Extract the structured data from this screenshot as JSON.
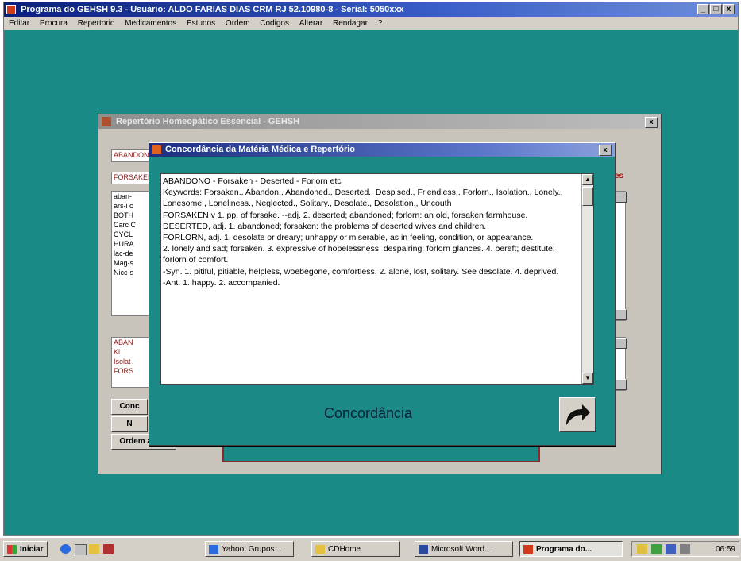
{
  "window": {
    "title": "Programa do GEHSH 9.3 - Usuário: ALDO FARIAS DIAS CRM RJ 52.10980-8 - Serial: 5050xxx",
    "buttons": [
      "_",
      "□",
      "x"
    ]
  },
  "menu": [
    "Editar",
    "Procura",
    "Repertorio",
    "Medicamentos",
    "Estudos",
    "Ordem",
    "Codigos",
    "Alterar",
    "Rendagar",
    "?"
  ],
  "back_dialog": {
    "title": "Repertório Homeopático Essencial - GEHSH",
    "close": "x",
    "field_top_1": "ABANDONO",
    "field_top_2": "FORSAKEN",
    "right_label": "es",
    "list_items": [
      "aban-",
      "ars-i c",
      "BOTH",
      "Carc C",
      "CYCL",
      "HURA",
      "lac-de",
      "Mag-s",
      "Nicc-s"
    ],
    "field_bottom": [
      "ABAN",
      "Ki",
      "Isolat",
      "FORS"
    ],
    "button_conc": "Conc",
    "button_n": "N",
    "button_order": "Ordem alfab."
  },
  "front_dialog": {
    "title": "Concordância da Matéria Médica e Repertório",
    "close": "x",
    "paragraphs": [
      "ABANDONO - Forsaken - Deserted - Forlorn etc",
      "      Keywords: Forsaken., Abandon., Abandoned., Deserted., Despised., Friendless., Forlorn., Isolation., Lonely., Lonesome., Loneliness., Neglected., Solitary., Desolate., Desolation., Uncouth",
      "FORSAKEN v 1.    pp. of forsake. --adj. 2.     deserted; abandoned; forlorn: an old, forsaken farmhouse.",
      "DESERTED, adj. 1.    abandoned; forsaken: the problems of deserted wives and children.",
      "FORLORN, adj. 1.     desolate or dreary; unhappy or miserable, as in feeling, condition, or appearance.",
      "2.  lonely and sad; forsaken. 3.  expressive of hopelessness; despairing: forlorn glances. 4.     bereft; destitute: forlorn of comfort.",
      "-Syn. 1. pitiful, pitiable, helpless, woebegone, comfortless. 2. alone, lost, solitary. See desolate. 4. deprived.",
      "-Ant. 1. happy. 2. accompanied."
    ],
    "bottom_label": "Concordância",
    "scroll_up": "▲",
    "scroll_down": "▼"
  },
  "taskbar": {
    "start": "Iniciar",
    "items": [
      "Yahoo! Grupos ...",
      "CDHome",
      "Microsoft Word...",
      "Programa do..."
    ],
    "clock": "06:59"
  },
  "colors": {
    "desktop": "#1a8a86",
    "title_active": "#0a1f7a",
    "field_text": "#8a1a1a"
  },
  "icons": [
    "app-icon",
    "arrow-right-icon",
    "windows-logo-icon",
    "ie-icon",
    "folder-icon",
    "word-icon",
    "speaker-icon"
  ]
}
